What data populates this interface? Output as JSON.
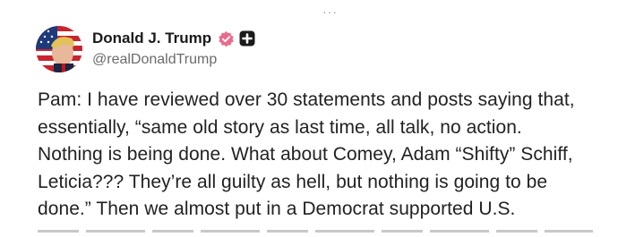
{
  "post": {
    "menu_icon": "more-horizontal-icon",
    "author": {
      "display_name": "Donald J. Trump",
      "handle": "@realDonaldTrump",
      "verified_icon": "verified-badge-icon",
      "badge_icon": "plus-square-icon",
      "verified_color": "#ec6a8c"
    },
    "body_lines": [
      "Pam: I have reviewed over 30 statements and posts saying that,",
      "essentially, “same old story as last time, all talk, no action.",
      "Nothing is being done. What about Comey, Adam “Shifty” Schiff,",
      "Leticia??? They’re all guilty as hell, but nothing is going to be",
      "done.” Then we almost put in a Democrat supported U.S."
    ]
  }
}
